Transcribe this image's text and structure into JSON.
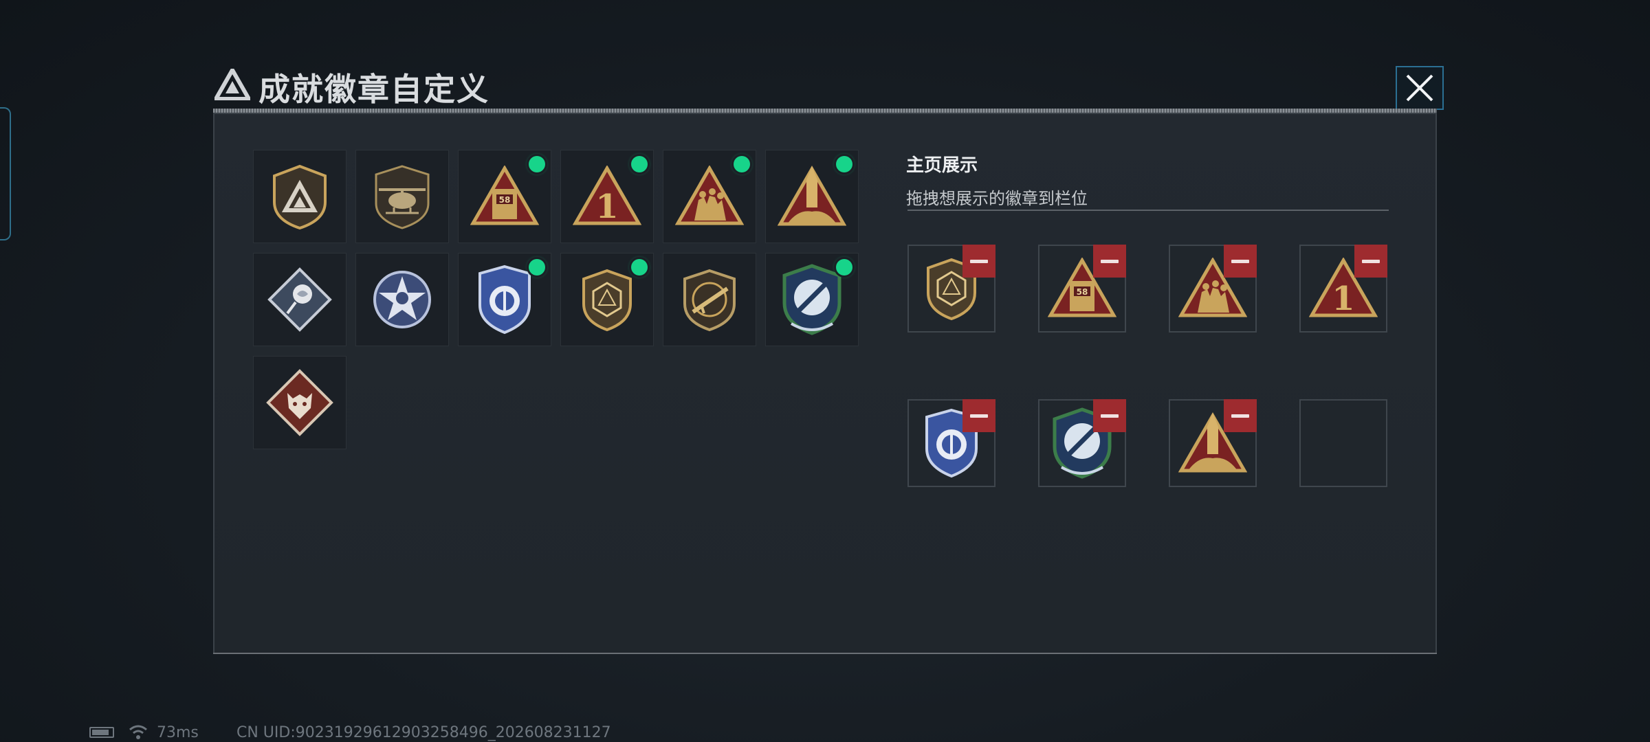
{
  "dialog": {
    "title": "成就徽章自定义"
  },
  "inventory": {
    "badges": [
      {
        "icon": "shield-pyramid-icon",
        "new": false
      },
      {
        "icon": "helicopter-shield-icon",
        "new": false
      },
      {
        "icon": "triangle-58-icon",
        "new": true
      },
      {
        "icon": "triangle-number-1-icon",
        "new": true
      },
      {
        "icon": "triangle-soldiers-icon",
        "new": true
      },
      {
        "icon": "triangle-rocket-icon",
        "new": true
      },
      {
        "icon": "diamond-rose-icon",
        "new": false
      },
      {
        "icon": "star-skull-icon",
        "new": false
      },
      {
        "icon": "blue-police-badge-icon",
        "new": true
      },
      {
        "icon": "d20-dice-shield-icon",
        "new": true
      },
      {
        "icon": "rifle-shield-icon",
        "new": false
      },
      {
        "icon": "missile-crest-icon",
        "new": true
      },
      {
        "icon": "wolf-diamond-icon",
        "new": false
      }
    ]
  },
  "showcase": {
    "title": "主页展示",
    "subtitle": "拖拽想展示的徽章到栏位",
    "slots": [
      {
        "icon": "d20-dice-shield-icon",
        "filled": true
      },
      {
        "icon": "triangle-58-icon",
        "filled": true
      },
      {
        "icon": "triangle-soldiers-icon",
        "filled": true
      },
      {
        "icon": "triangle-number-1-icon",
        "filled": true
      },
      {
        "icon": "blue-police-badge-icon",
        "filled": true
      },
      {
        "icon": "missile-crest-icon",
        "filled": true
      },
      {
        "icon": "triangle-rocket-icon",
        "filled": true
      },
      {
        "icon": "",
        "filled": false
      }
    ]
  },
  "status_bar": {
    "ping": "73ms",
    "uid": "CN UID:90231929612903258496_202608231127"
  },
  "colors": {
    "new_dot": "#17d48a",
    "remove_button": "#9e2b2f",
    "gold": "#c9a45c",
    "triangle_red": "#7a2222",
    "blue_badge": "#3a55a0",
    "frame_blue": "#2b6f93"
  }
}
